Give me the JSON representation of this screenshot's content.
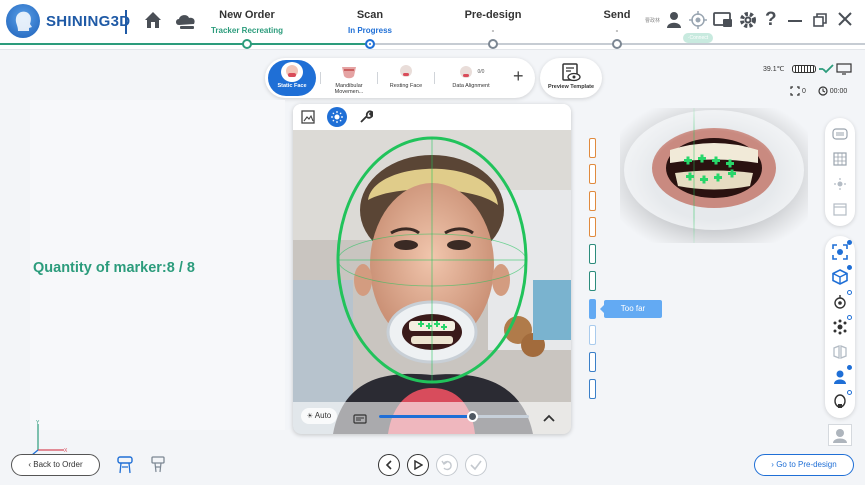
{
  "header": {
    "brand": "SHINING3D",
    "steps": [
      {
        "title": "New Order",
        "status": "Tracker Recreating"
      },
      {
        "title": "Scan",
        "status": "In Progress"
      },
      {
        "title": "Pre-design",
        "status": "-"
      },
      {
        "title": "Send",
        "status": "-"
      }
    ],
    "user_name": "曹政林",
    "tracker_pill": "·Connect",
    "icons": [
      "home-icon",
      "cloud-icon",
      "user-icon",
      "tracker-icon",
      "screen-record-icon",
      "settings-icon",
      "help-icon",
      "minimize-icon",
      "restore-icon",
      "close-icon"
    ]
  },
  "modes": {
    "items": [
      {
        "label": "Static Face",
        "active": true
      },
      {
        "label": "Mandibular Movemen...",
        "active": false
      },
      {
        "label": "Resting Face",
        "active": false
      },
      {
        "label": "Data Alignment",
        "active": false,
        "count": "0/0"
      }
    ],
    "add_label": "+",
    "preview_template": "Preview Template"
  },
  "status": {
    "temperature": "39.1℃",
    "scan_count": "0",
    "timer": "00:00"
  },
  "marker": {
    "label": "Quantity of marker:8 / 8"
  },
  "camera": {
    "auto_label": "Auto",
    "exposure": 0.62,
    "toolbar_icons": [
      "image-icon",
      "brightness-icon",
      "wrench-icon"
    ]
  },
  "distance": {
    "message": "Too far",
    "active_index": 6
  },
  "bottom": {
    "back_label": "Back to Order",
    "next_label": "Go to Pre-design"
  },
  "colors": {
    "accent": "#1f6fd6",
    "success": "#2c9c7c",
    "face_guide": "#21c35b",
    "dist_orange": "#e08a3e",
    "dist_teal": "#2c8c7c",
    "dist_blue": "#3a7fc8"
  }
}
